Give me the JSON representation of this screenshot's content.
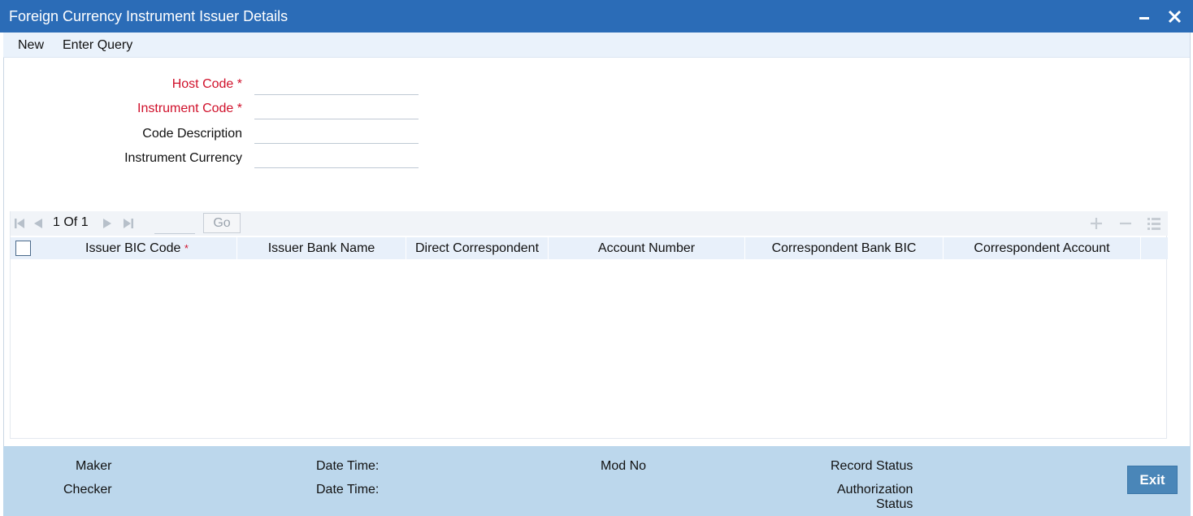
{
  "window": {
    "title": "Foreign Currency Instrument Issuer Details",
    "minimize_icon": "minimize-icon",
    "close_icon": "close-icon"
  },
  "menu": {
    "items": [
      "New",
      "Enter Query"
    ]
  },
  "form": {
    "host_code": {
      "label": "Host Code",
      "required_marker": "*",
      "value": ""
    },
    "instrument_code": {
      "label": "Instrument Code",
      "required_marker": "*",
      "value": ""
    },
    "code_description": {
      "label": "Code Description",
      "value": ""
    },
    "instrument_currency": {
      "label": "Instrument Currency",
      "value": ""
    }
  },
  "grid": {
    "pagination": {
      "current": "1",
      "of_label": "Of",
      "total": "1",
      "go_label": "Go"
    },
    "columns": [
      {
        "label": "Issuer BIC Code",
        "required_marker": "*"
      },
      {
        "label": "Issuer Bank Name"
      },
      {
        "label": "Direct Correspondent"
      },
      {
        "label": "Account Number"
      },
      {
        "label": "Correspondent Bank BIC"
      },
      {
        "label": "Correspondent Account"
      }
    ],
    "rows": []
  },
  "footer": {
    "maker_label": "Maker",
    "checker_label": "Checker",
    "date_time_label_1": "Date Time:",
    "date_time_label_2": "Date Time:",
    "mod_no_label": "Mod No",
    "record_status_label": "Record Status",
    "authorization_status_label_line1": "Authorization",
    "authorization_status_label_line2": "Status",
    "exit_label": "Exit"
  },
  "colors": {
    "titlebar": "#2b6cb7",
    "required": "#d0112b",
    "footer": "#bcd7ec",
    "exit_button": "#4a86b8"
  }
}
